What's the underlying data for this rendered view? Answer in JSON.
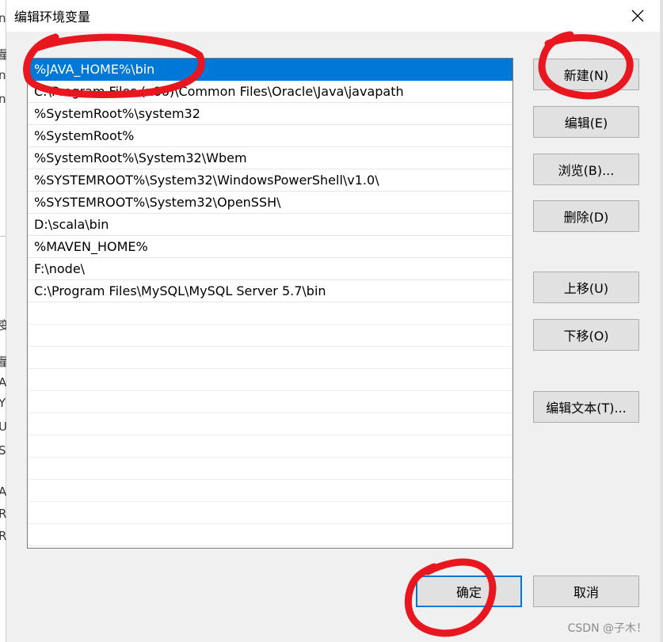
{
  "dialog": {
    "title": "编辑环境变量"
  },
  "list": {
    "items": [
      "%JAVA_HOME%\\bin",
      "C:\\Program Files (x86)\\Common Files\\Oracle\\Java\\javapath",
      "%SystemRoot%\\system32",
      "%SystemRoot%",
      "%SystemRoot%\\System32\\Wbem",
      "%SYSTEMROOT%\\System32\\WindowsPowerShell\\v1.0\\",
      "%SYSTEMROOT%\\System32\\OpenSSH\\",
      "D:\\scala\\bin",
      "%MAVEN_HOME%",
      "F:\\node\\",
      "C:\\Program Files\\MySQL\\MySQL Server 5.7\\bin"
    ],
    "selected_index": 0
  },
  "buttons": {
    "new": "新建(N)",
    "edit": "编辑(E)",
    "browse": "浏览(B)...",
    "delete": "删除(D)",
    "move_up": "上移(U)",
    "move_down": "下移(O)",
    "edit_text": "编辑文本(T)...",
    "ok": "确定",
    "cancel": "取消"
  },
  "watermark": "CSDN @子木！",
  "colors": {
    "selection": "#0078d7",
    "annotation": "#e8161f"
  }
}
